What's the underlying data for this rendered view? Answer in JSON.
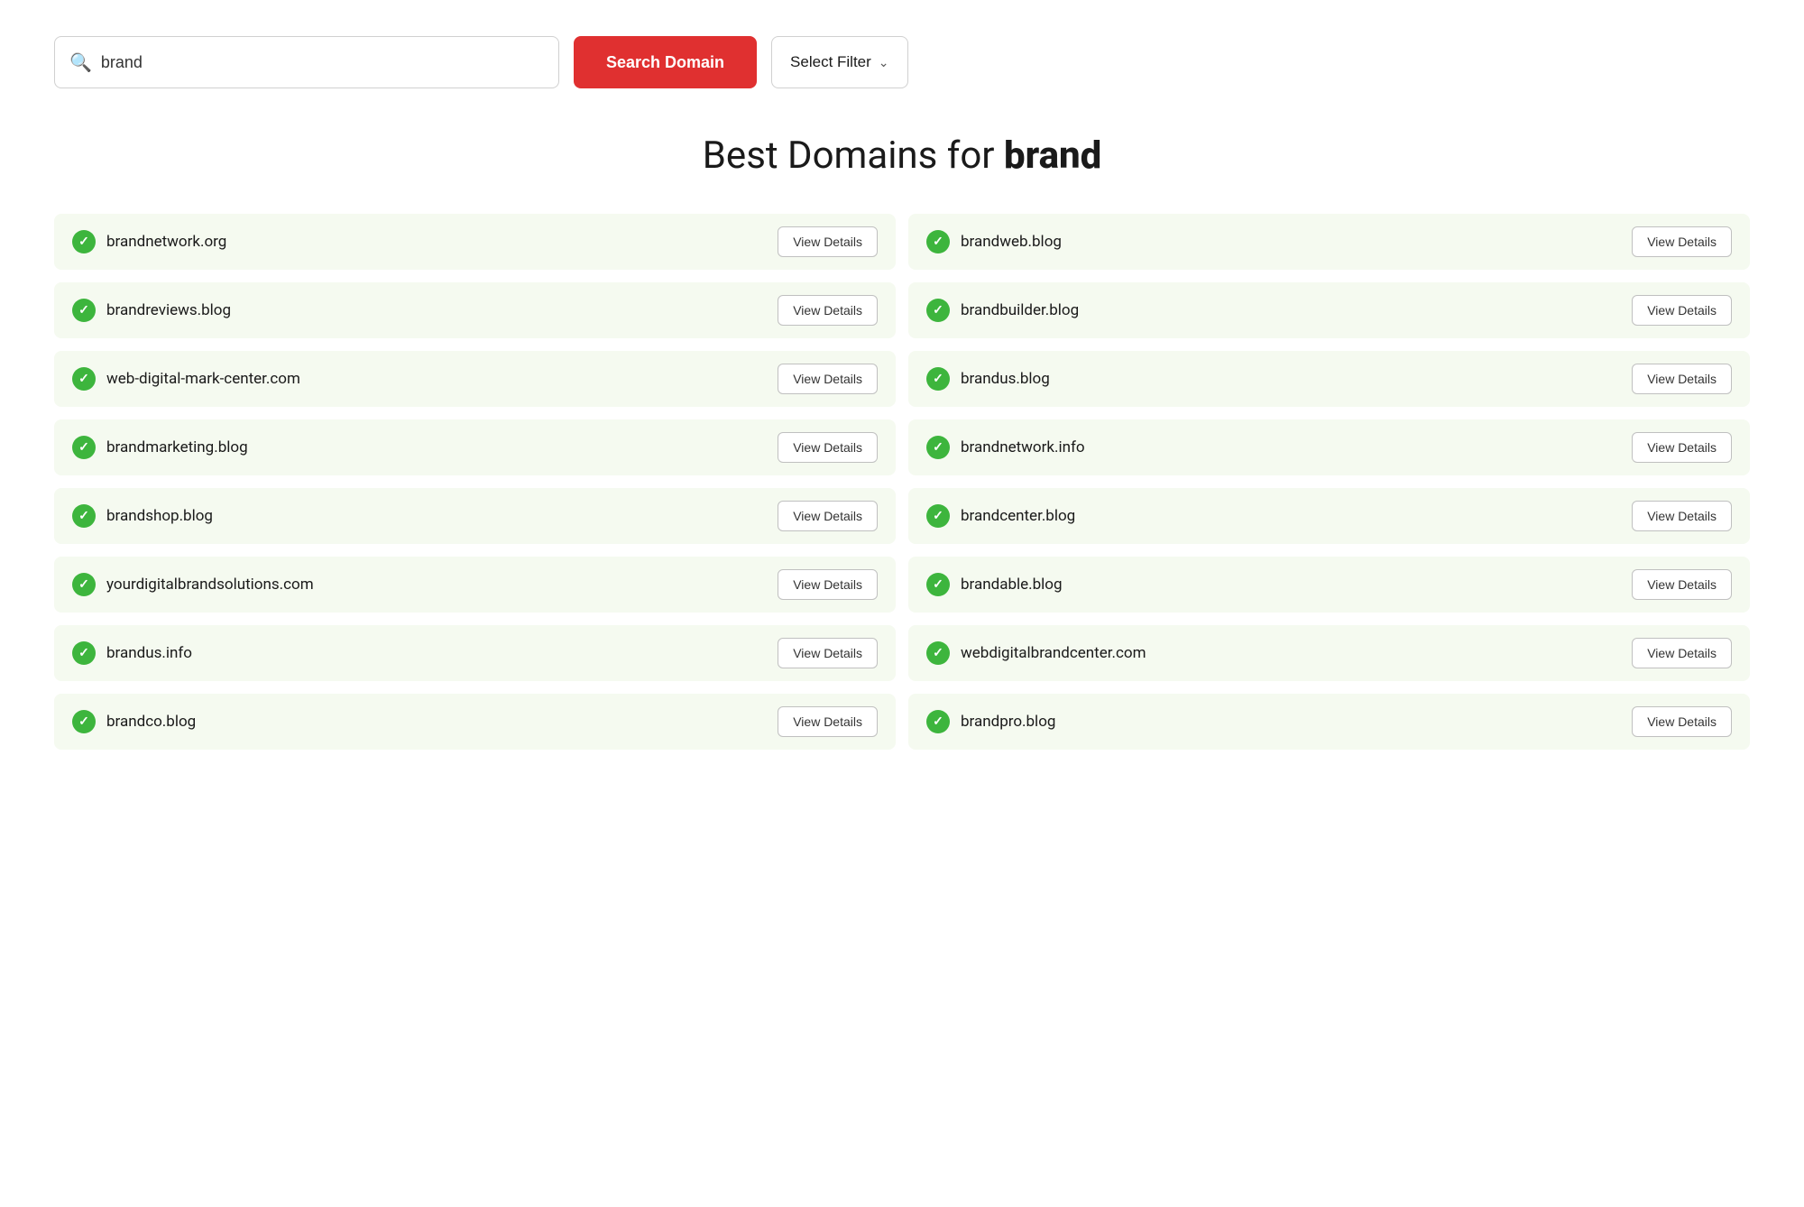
{
  "search": {
    "placeholder": "brand",
    "value": "brand",
    "search_label": "Search Domain",
    "filter_label": "Select Filter"
  },
  "title": {
    "prefix": "Best Domains for ",
    "keyword": "brand"
  },
  "domains": [
    {
      "name": "brandnetwork.org",
      "col": "left"
    },
    {
      "name": "brandweb.blog",
      "col": "right"
    },
    {
      "name": "brandreviews.blog",
      "col": "left"
    },
    {
      "name": "brandbuilder.blog",
      "col": "right"
    },
    {
      "name": "web-digital-mark-center.com",
      "col": "left"
    },
    {
      "name": "brandus.blog",
      "col": "right"
    },
    {
      "name": "brandmarketing.blog",
      "col": "left"
    },
    {
      "name": "brandnetwork.info",
      "col": "right"
    },
    {
      "name": "brandshop.blog",
      "col": "left"
    },
    {
      "name": "brandcenter.blog",
      "col": "right"
    },
    {
      "name": "yourdigitalbrandsolutions.com",
      "col": "left"
    },
    {
      "name": "brandable.blog",
      "col": "right"
    },
    {
      "name": "brandus.info",
      "col": "left"
    },
    {
      "name": "webdigitalbrandcenter.com",
      "col": "right"
    },
    {
      "name": "brandco.blog",
      "col": "left"
    },
    {
      "name": "brandpro.blog",
      "col": "right"
    }
  ],
  "view_details_label": "View Details",
  "colors": {
    "search_btn": "#e03030",
    "check": "#3db53d",
    "domain_bg": "#f5faf0"
  }
}
